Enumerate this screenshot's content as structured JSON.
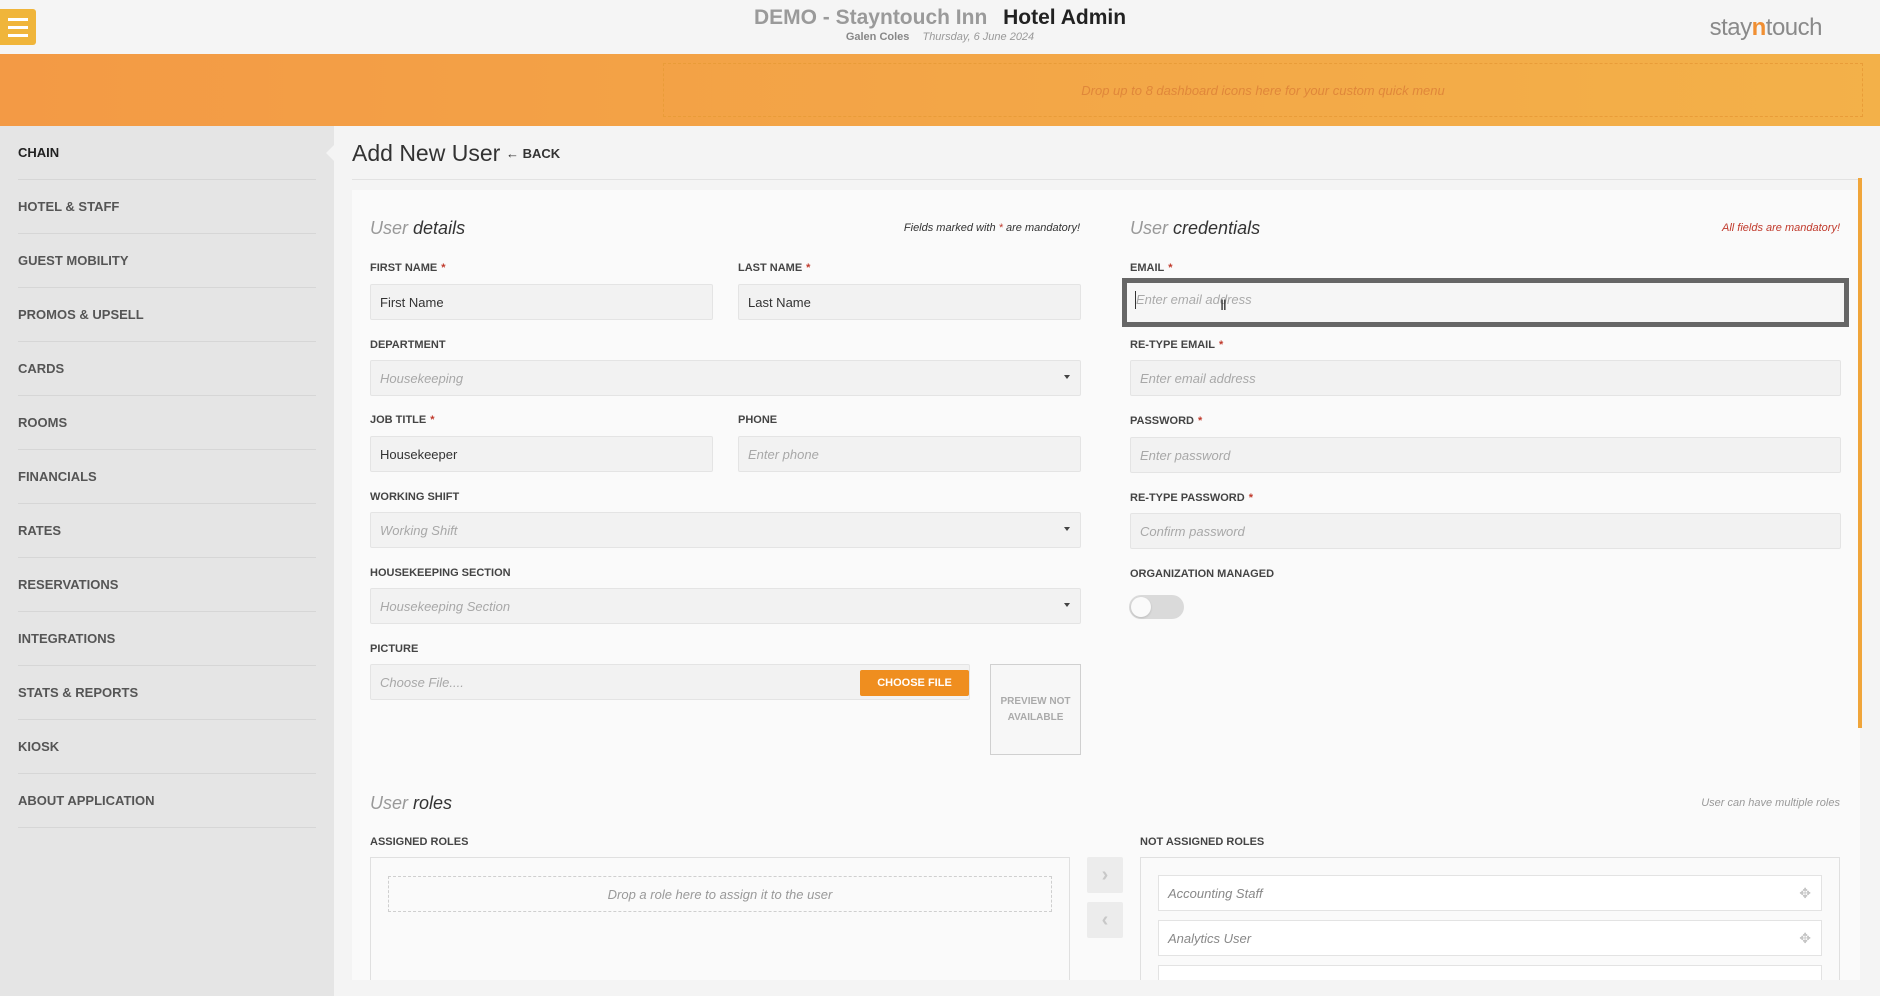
{
  "header": {
    "hotel_name": "DEMO - Stayntouch Inn",
    "app_name": "Hotel Admin",
    "user_name": "Galen Coles",
    "date": "Thursday, 6 June 2024",
    "logo_left": "stay",
    "logo_mid": "n",
    "logo_right": "touch"
  },
  "quick_menu": {
    "placeholder": "Drop up to 8 dashboard icons here for your custom quick menu"
  },
  "sidebar": {
    "items": [
      {
        "label": "CHAIN"
      },
      {
        "label": "HOTEL & STAFF"
      },
      {
        "label": "GUEST MOBILITY"
      },
      {
        "label": "PROMOS & UPSELL"
      },
      {
        "label": "CARDS"
      },
      {
        "label": "ROOMS"
      },
      {
        "label": "FINANCIALS"
      },
      {
        "label": "RATES"
      },
      {
        "label": "RESERVATIONS"
      },
      {
        "label": "INTEGRATIONS"
      },
      {
        "label": "STATS & REPORTS"
      },
      {
        "label": "KIOSK"
      },
      {
        "label": "ABOUT APPLICATION"
      }
    ],
    "active": "CHAIN"
  },
  "page": {
    "title": "Add New User",
    "back_label": "BACK"
  },
  "user_details": {
    "title_prefix": "User",
    "title_main": "details",
    "note_pre": "Fields marked with",
    "note_star": "*",
    "note_post": "are mandatory!",
    "first_name": {
      "label": "FIRST NAME",
      "value": "First Name"
    },
    "last_name": {
      "label": "LAST NAME",
      "value": "Last Name"
    },
    "department": {
      "label": "DEPARTMENT",
      "value": "Housekeeping"
    },
    "job_title": {
      "label": "JOB TITLE",
      "value": "Housekeeper"
    },
    "phone": {
      "label": "PHONE",
      "placeholder": "Enter phone"
    },
    "working_shift": {
      "label": "WORKING SHIFT",
      "value": "Working Shift"
    },
    "housekeeping_section": {
      "label": "HOUSEKEEPING SECTION",
      "value": "Housekeeping Section"
    },
    "picture": {
      "label": "PICTURE",
      "placeholder": "Choose File....",
      "button": "CHOOSE FILE",
      "preview": "PREVIEW NOT AVAILABLE"
    }
  },
  "user_credentials": {
    "title_prefix": "User",
    "title_main": "credentials",
    "note": "All fields are mandatory!",
    "email": {
      "label": "EMAIL",
      "placeholder": "Enter email address"
    },
    "retype_email": {
      "label": "RE-TYPE EMAIL",
      "placeholder": "Enter email address"
    },
    "password": {
      "label": "PASSWORD",
      "placeholder": "Enter password"
    },
    "retype_password": {
      "label": "RE-TYPE PASSWORD",
      "placeholder": "Confirm password"
    },
    "org_managed": {
      "label": "ORGANIZATION MANAGED",
      "on": false
    }
  },
  "user_roles": {
    "title_prefix": "User",
    "title_main": "roles",
    "note": "User can have multiple roles",
    "assigned_label": "ASSIGNED ROLES",
    "assigned_placeholder": "Drop a role here to assign it to the user",
    "not_assigned_label": "NOT ASSIGNED ROLES",
    "not_assigned": [
      "Accounting Staff",
      "Analytics User"
    ]
  },
  "colors": {
    "accent": "#f0b53a",
    "band_start": "#f39a45",
    "button": "#ef8e1f",
    "required": "#c0392b"
  }
}
